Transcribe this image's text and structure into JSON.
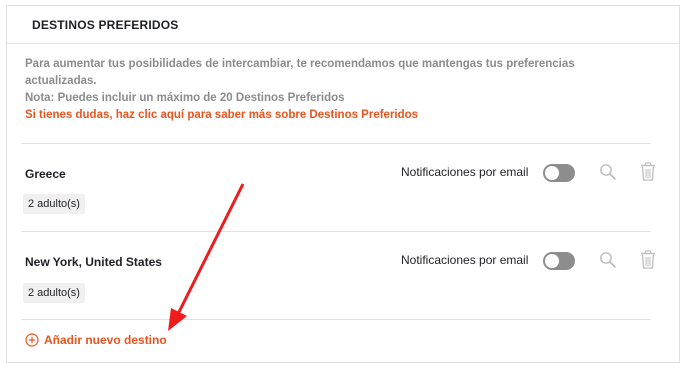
{
  "section": {
    "title": "DESTINOS PREFERIDOS"
  },
  "intro": {
    "line1": "Para aumentar tus posibilidades de intercambiar, te recomendamos que mantengas tus preferencias",
    "line2": "actualizadas.",
    "note": "Nota: Puedes incluir un máximo de 20 Destinos Preferidos",
    "help_link": "Si tienes dudas, haz clic aquí para saber más sobre Destinos Preferidos"
  },
  "destinations": [
    {
      "name": "Greece",
      "guests": "2 adulto(s)",
      "notification_label": "Notificaciones por email",
      "email_notifications": false
    },
    {
      "name": "New York, United States",
      "guests": "2 adulto(s)",
      "notification_label": "Notificaciones por email",
      "email_notifications": false
    }
  ],
  "add_button": {
    "label": "Añadir nuevo destino"
  },
  "colors": {
    "accent": "#e8541e",
    "muted_text": "#8c8c8c",
    "toggle_off": "#8d8d8d",
    "annotation_arrow": "#ee1c1c"
  },
  "icons": [
    "search-icon",
    "trash-icon",
    "plus-circle-icon"
  ]
}
